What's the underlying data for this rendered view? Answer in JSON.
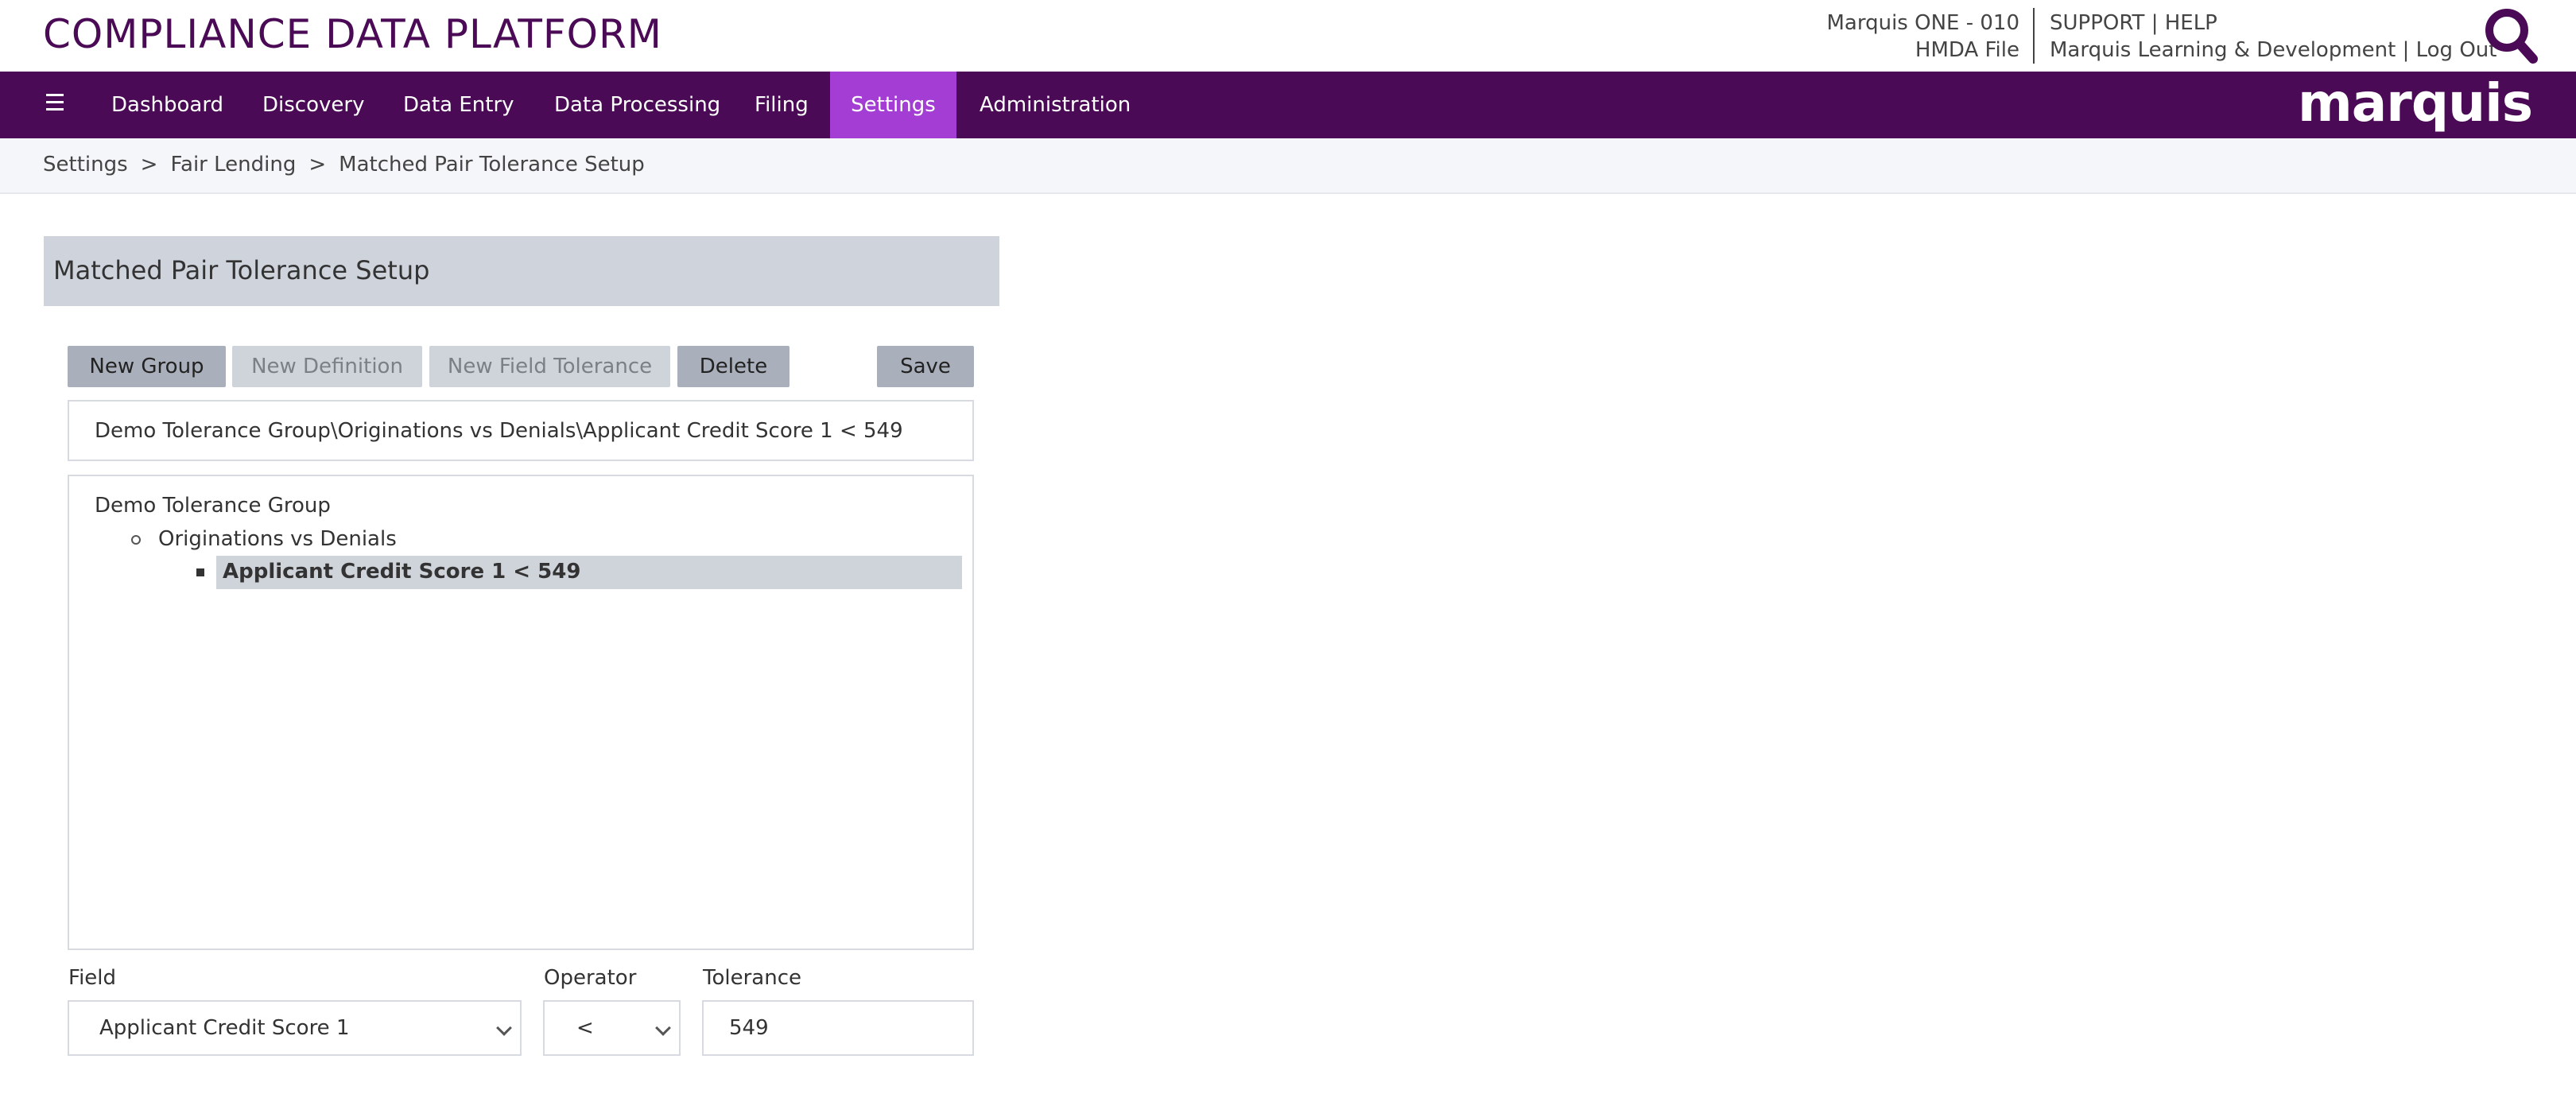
{
  "header": {
    "app_title": "COMPLIANCE DATA PLATFORM",
    "org_name": "Marquis ONE - 010",
    "file_name": "HMDA File",
    "support_label": "SUPPORT",
    "help_label": "HELP",
    "user_name": "Marquis Learning & Development",
    "logout_label": "Log Out",
    "link_separator": "|",
    "search_icon": "search-icon"
  },
  "nav": {
    "menu_icon": "hamburger-menu-icon",
    "items": [
      {
        "label": "Dashboard"
      },
      {
        "label": "Discovery"
      },
      {
        "label": "Data Entry"
      },
      {
        "label": "Data Processing"
      },
      {
        "label": "Filing"
      },
      {
        "label": "Settings",
        "active": true
      },
      {
        "label": "Administration"
      }
    ],
    "brand": "marquis",
    "active_color": "#a33dd3",
    "bar_color": "#4b0a55"
  },
  "breadcrumb": {
    "items": [
      "Settings",
      "Fair Lending",
      "Matched Pair Tolerance Setup"
    ],
    "separator": ">"
  },
  "panel": {
    "title": "Matched Pair Tolerance Setup",
    "buttons": {
      "new_group": "New Group",
      "new_definition": "New Definition",
      "new_field_tolerance": "New Field Tolerance",
      "delete": "Delete",
      "save": "Save"
    },
    "path": "Demo Tolerance Group\\Originations vs Denials\\Applicant Credit Score 1 < 549",
    "tree": {
      "group": "Demo Tolerance Group",
      "definition": "Originations vs Denials",
      "selected_tolerance": "Applicant Credit Score 1 < 549"
    },
    "form": {
      "field_label": "Field",
      "field_value": "Applicant Credit Score 1",
      "operator_label": "Operator",
      "operator_value": "<",
      "tolerance_label": "Tolerance",
      "tolerance_value": "549"
    }
  }
}
